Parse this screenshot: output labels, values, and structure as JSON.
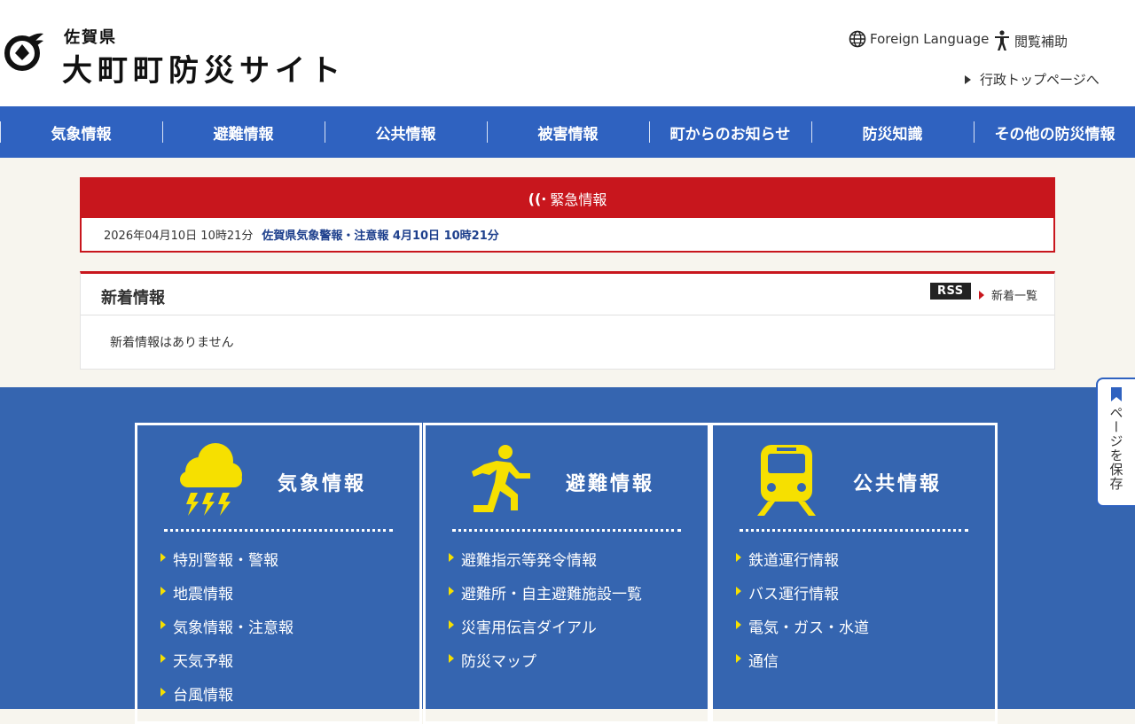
{
  "header": {
    "prefecture": "佐賀県",
    "site_title": "大町町防災サイト",
    "foreign_language": "Foreign Language",
    "accessibility": "閲覧補助",
    "gov_top_link": "行政トップページへ",
    "icons": {
      "logo": "town-emblem",
      "foreign": "globe-icon",
      "assist": "person-icon"
    }
  },
  "nav": {
    "items": [
      {
        "label": "気象情報"
      },
      {
        "label": "避難情報"
      },
      {
        "label": "公共情報"
      },
      {
        "label": "被害情報"
      },
      {
        "label": "町からのお知らせ"
      },
      {
        "label": "防災知識"
      },
      {
        "label": "その他の防災情報"
      }
    ]
  },
  "emergency": {
    "title": "緊急情報",
    "date": "2026年04月10日 10時21分",
    "link": "佐賀県気象警報・注意報 4月10日 10時21分"
  },
  "news": {
    "title": "新着情報",
    "rss": "RSS",
    "more": "新着一覧",
    "empty": "新着情報はありません"
  },
  "categories": [
    {
      "title": "気象情報",
      "icon": "thunderstorm-icon",
      "links": [
        "特別警報・警報",
        "地震情報",
        "気象情報・注意報",
        "天気予報",
        "台風情報"
      ]
    },
    {
      "title": "避難情報",
      "icon": "running-person-icon",
      "links": [
        "避難指示等発令情報",
        "避難所・自主避難施設一覧",
        "災害用伝言ダイアル",
        "防災マップ"
      ]
    },
    {
      "title": "公共情報",
      "icon": "train-icon",
      "links": [
        "鉄道運行情報",
        "バス運行情報",
        "電気・ガス・水道",
        "通信"
      ]
    }
  ],
  "side_tab": {
    "label": "ページを保存",
    "icon": "bookmark-icon"
  },
  "colors": {
    "nav_blue": "#2f62c0",
    "section_blue": "#3565b0",
    "emergency_red": "#c8161d",
    "accent_yellow": "#f6e000"
  }
}
